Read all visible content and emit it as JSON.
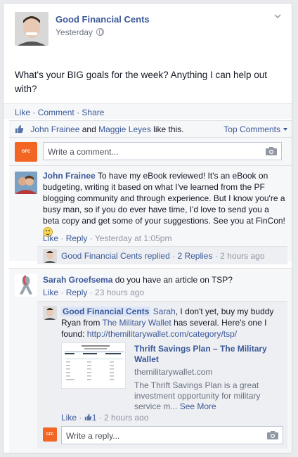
{
  "post": {
    "page_name": "Good Financial Cents",
    "time": "Yesterday",
    "text": "What's your BIG goals for the week? Anything I can help out with?"
  },
  "actions": {
    "like": "Like",
    "comment": "Comment",
    "share": "Share",
    "dot": "·"
  },
  "likes": {
    "liker1": "John Frainee",
    "and": "and",
    "liker2": "Maggie Leyes",
    "suffix": "like this.",
    "top_comments": "Top Comments"
  },
  "comment_input": {
    "placeholder": "Write a comment...",
    "logo_text": "GFC"
  },
  "comment1": {
    "author": "John Frainee",
    "text": "To have my eBook reviewed! It's an eBook on budgeting, writing it based on what I've learned from the PF blogging community and through experience. But I know you're a busy man, so if you do ever have time, I'd love to send you a beta copy and get some of your suggestions. See you at FinCon!",
    "like": "Like",
    "reply": "Reply",
    "time": "Yesterday at 1:05pm",
    "replied_name": "Good Financial Cents replied",
    "replies_count": "2 Replies",
    "replies_time": "2 hours ago"
  },
  "comment2": {
    "author": "Sarah Groefsema",
    "text": "do you have an article on TSP?",
    "like": "Like",
    "reply": "Reply",
    "time": "23 hours ago"
  },
  "reply1": {
    "author": "Good Financial Cents",
    "mention": "Sarah",
    "text_a": ", I don't yet, buy my buddy Ryan from",
    "link_name": "The Military Wallet",
    "text_b": "has several. Here's one I found:",
    "url": "http://themilitarywallet.com/category/tsp/",
    "preview_title": "Thrift Savings Plan – The Military Wallet",
    "preview_domain": "themilitarywallet.com",
    "preview_desc": "The Thrift Savings Plan is a great investment opportunity for military service m...",
    "see_more": "See More",
    "like": "Like",
    "like_count": "1",
    "time": "2 hours ago"
  },
  "reply_input": {
    "placeholder": "Write a reply..."
  },
  "colors": {
    "link": "#3b5998",
    "meta": "#9197a3",
    "panel": "#f6f7f9",
    "brand_orange": "#f26522"
  }
}
